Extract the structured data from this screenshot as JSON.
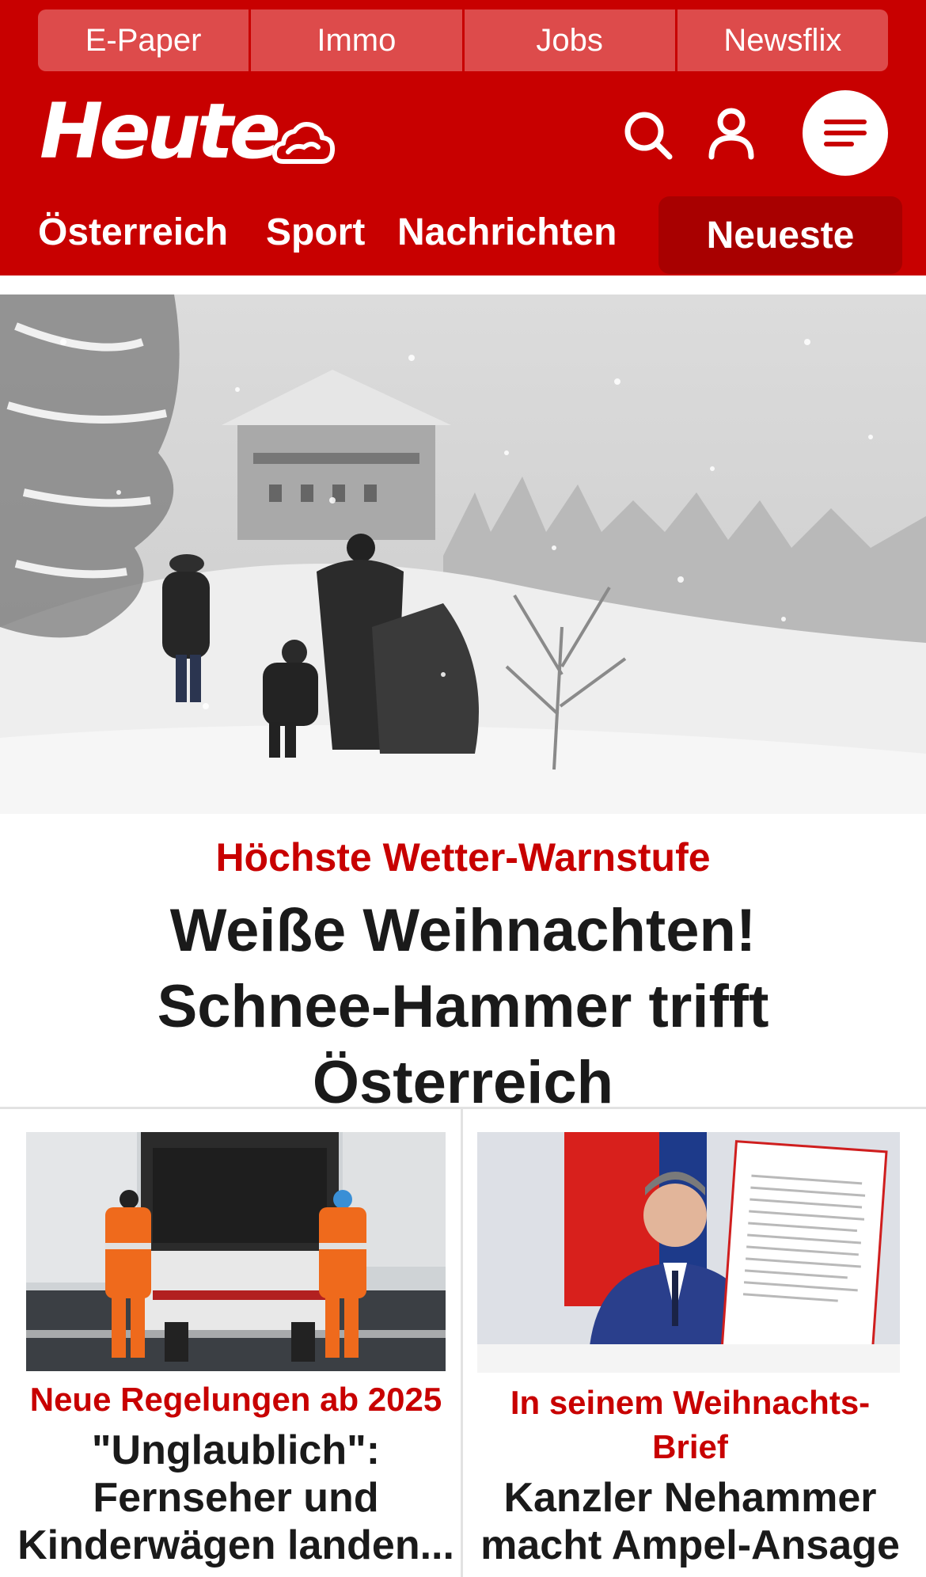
{
  "topnav": {
    "items": [
      "E-Paper",
      "Immo",
      "Jobs",
      "Newsflix"
    ]
  },
  "brand": {
    "logo_text": "Heute",
    "color": "#c80000"
  },
  "icons": {
    "weather": "cloud-icon",
    "search": "search-icon",
    "account": "user-icon",
    "menu": "menu-icon"
  },
  "catnav": {
    "items": [
      "Österreich",
      "Sport",
      "Nachrichten"
    ],
    "active": "Neueste"
  },
  "hero": {
    "kicker": "Höchste Wetter-Warnstufe",
    "title": "Weiße Weihnachten! Schnee-Hammer trifft Österreich"
  },
  "cards": [
    {
      "kicker": "Neue Regelungen ab 2025",
      "title_lines": [
        "\"Unglaublich\":",
        "Fernseher und",
        "Kinderwägen landen..."
      ]
    },
    {
      "kicker_lines": [
        "In seinem Weihnachts-",
        "Brief"
      ],
      "title_lines": [
        "Kanzler Nehammer",
        "macht Ampel-Ansage"
      ]
    }
  ]
}
